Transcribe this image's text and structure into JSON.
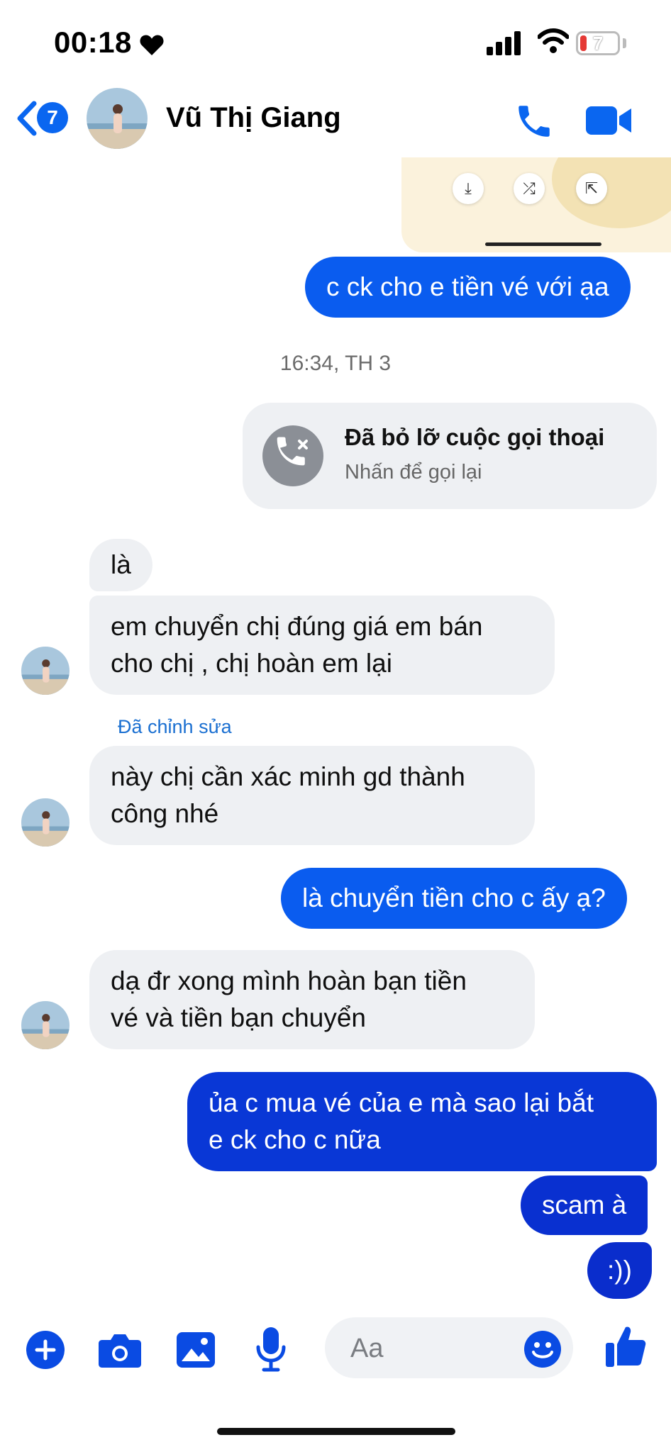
{
  "status_bar": {
    "time": "00:18",
    "battery": "7"
  },
  "header": {
    "back_badge": "7",
    "contact_name": "Vũ Thị Giang"
  },
  "messages": {
    "m1": "c ck cho e tiền vé với ạa",
    "timestamp": "16:34, TH 3",
    "missed_call_title": "Đã bỏ lỡ cuộc gọi thoại",
    "missed_call_sub": "Nhấn để gọi lại",
    "m2": "là",
    "m3_line1": "em chuyển chị đúng giá em bán",
    "m3_line2": "cho chị , chị hoàn em lại",
    "edited_label": "Đã chỉnh sửa",
    "m4_line1": "này chị cần xác minh gd thành",
    "m4_line2": "công nhé",
    "m5": "là chuyển tiền cho c ấy ạ?",
    "m6_line1": "dạ đr xong mình hoàn bạn tiền",
    "m6_line2": "vé và tiền bạn chuyển",
    "m7_line1": "ủa c mua vé của e mà sao lại bắt",
    "m7_line2": "e ck cho c nữa",
    "m8": "scam à",
    "m9": ":))"
  },
  "composer": {
    "placeholder": "Aa"
  },
  "icons": {
    "status": [
      "heart-icon",
      "signal-icon",
      "wifi-icon",
      "battery-icon"
    ],
    "header": [
      "back-chevron-icon",
      "phone-icon",
      "video-camera-icon"
    ],
    "composer": [
      "plus-icon",
      "camera-icon",
      "image-icon",
      "microphone-icon",
      "emoji-icon",
      "thumbs-up-icon"
    ]
  },
  "colors": {
    "accent": "#0a5cef",
    "incoming_bubble": "#eef0f3",
    "edited_label": "#1a6fd1"
  }
}
